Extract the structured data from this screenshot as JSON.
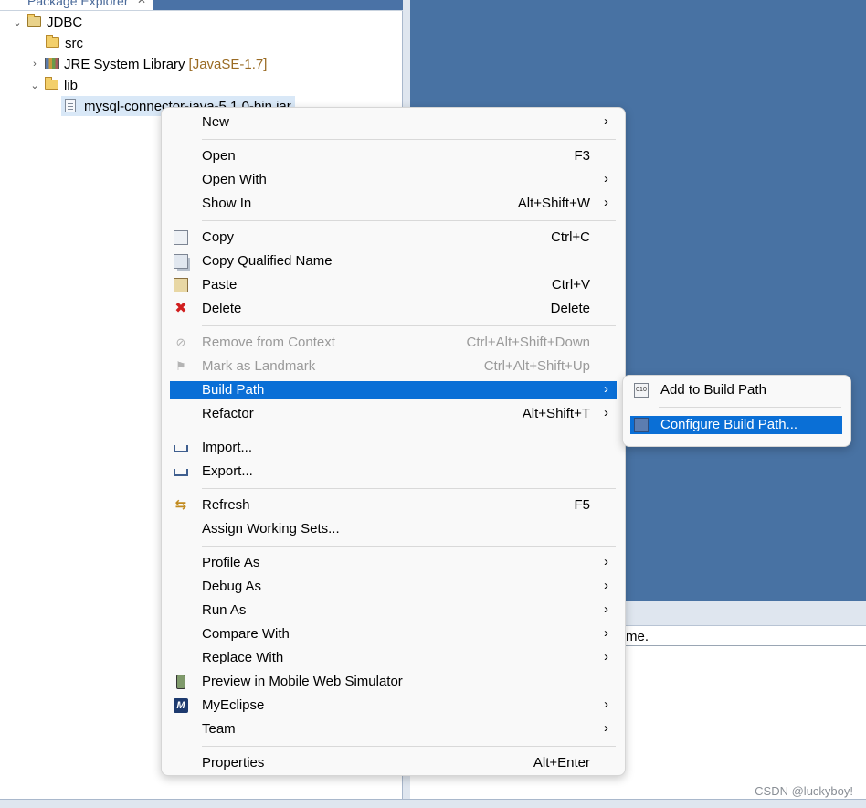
{
  "explorer": {
    "tab_label": "Package Explorer",
    "tree": [
      {
        "label": "JDBC",
        "twisty": "⌄"
      },
      {
        "label": "src"
      },
      {
        "label": "JRE System Library",
        "suffix": "[JavaSE-1.7]",
        "twisty": "›"
      },
      {
        "label": "lib",
        "twisty": "⌄"
      },
      {
        "label": "mysql-connector-java-5.1.0-bin.jar"
      }
    ]
  },
  "lower_pane": {
    "text": "me."
  },
  "context_menu": {
    "items": [
      {
        "label": "New",
        "shortcut": "",
        "arrow": "›"
      },
      {
        "label": "Open",
        "shortcut": "F3",
        "arrow": ""
      },
      {
        "label": "Open With",
        "shortcut": "",
        "arrow": "›"
      },
      {
        "label": "Show In",
        "shortcut": "Alt+Shift+W",
        "arrow": "›"
      },
      {
        "label": "Copy",
        "shortcut": "Ctrl+C",
        "arrow": "",
        "icon": "copy-icon"
      },
      {
        "label": "Copy Qualified Name",
        "shortcut": "",
        "arrow": "",
        "icon": "copy-qualified-icon"
      },
      {
        "label": "Paste",
        "shortcut": "Ctrl+V",
        "arrow": "",
        "icon": "paste-icon"
      },
      {
        "label": "Delete",
        "shortcut": "Delete",
        "arrow": "",
        "icon": "delete-icon"
      },
      {
        "label": "Remove from Context",
        "shortcut": "Ctrl+Alt+Shift+Down",
        "arrow": "",
        "icon": "remove-context-icon",
        "disabled": true
      },
      {
        "label": "Mark as Landmark",
        "shortcut": "Ctrl+Alt+Shift+Up",
        "arrow": "",
        "icon": "landmark-icon",
        "disabled": true
      },
      {
        "label": "Build Path",
        "shortcut": "",
        "arrow": "›",
        "highlighted": true
      },
      {
        "label": "Refactor",
        "shortcut": "Alt+Shift+T",
        "arrow": "›"
      },
      {
        "label": "Import...",
        "shortcut": "",
        "arrow": "",
        "icon": "import-icon"
      },
      {
        "label": "Export...",
        "shortcut": "",
        "arrow": "",
        "icon": "export-icon"
      },
      {
        "label": "Refresh",
        "shortcut": "F5",
        "arrow": "",
        "icon": "refresh-icon"
      },
      {
        "label": "Assign Working Sets...",
        "shortcut": "",
        "arrow": ""
      },
      {
        "label": "Profile As",
        "shortcut": "",
        "arrow": "›"
      },
      {
        "label": "Debug As",
        "shortcut": "",
        "arrow": "›"
      },
      {
        "label": "Run As",
        "shortcut": "",
        "arrow": "›"
      },
      {
        "label": "Compare With",
        "shortcut": "",
        "arrow": "›"
      },
      {
        "label": "Replace With",
        "shortcut": "",
        "arrow": "›"
      },
      {
        "label": "Preview in Mobile Web Simulator",
        "shortcut": "",
        "arrow": "",
        "icon": "mobile-simulator-icon"
      },
      {
        "label": "MyEclipse",
        "shortcut": "",
        "arrow": "›",
        "icon": "myeclipse-icon"
      },
      {
        "label": "Team",
        "shortcut": "",
        "arrow": "›"
      },
      {
        "label": "Properties",
        "shortcut": "Alt+Enter",
        "arrow": ""
      }
    ]
  },
  "build_path_submenu": {
    "items": [
      {
        "label": "Add to Build Path",
        "icon": "add-build-path-icon"
      },
      {
        "label": "Configure Build Path...",
        "icon": "configure-build-path-icon",
        "highlighted": true
      }
    ]
  },
  "watermark": "CSDN @luckyboy!",
  "colors": {
    "editor_background": "#4872a3",
    "menu_highlight": "#0a6fd6",
    "menu_background": "#f9f9f9",
    "jre_suffix": "#9a6b24"
  }
}
